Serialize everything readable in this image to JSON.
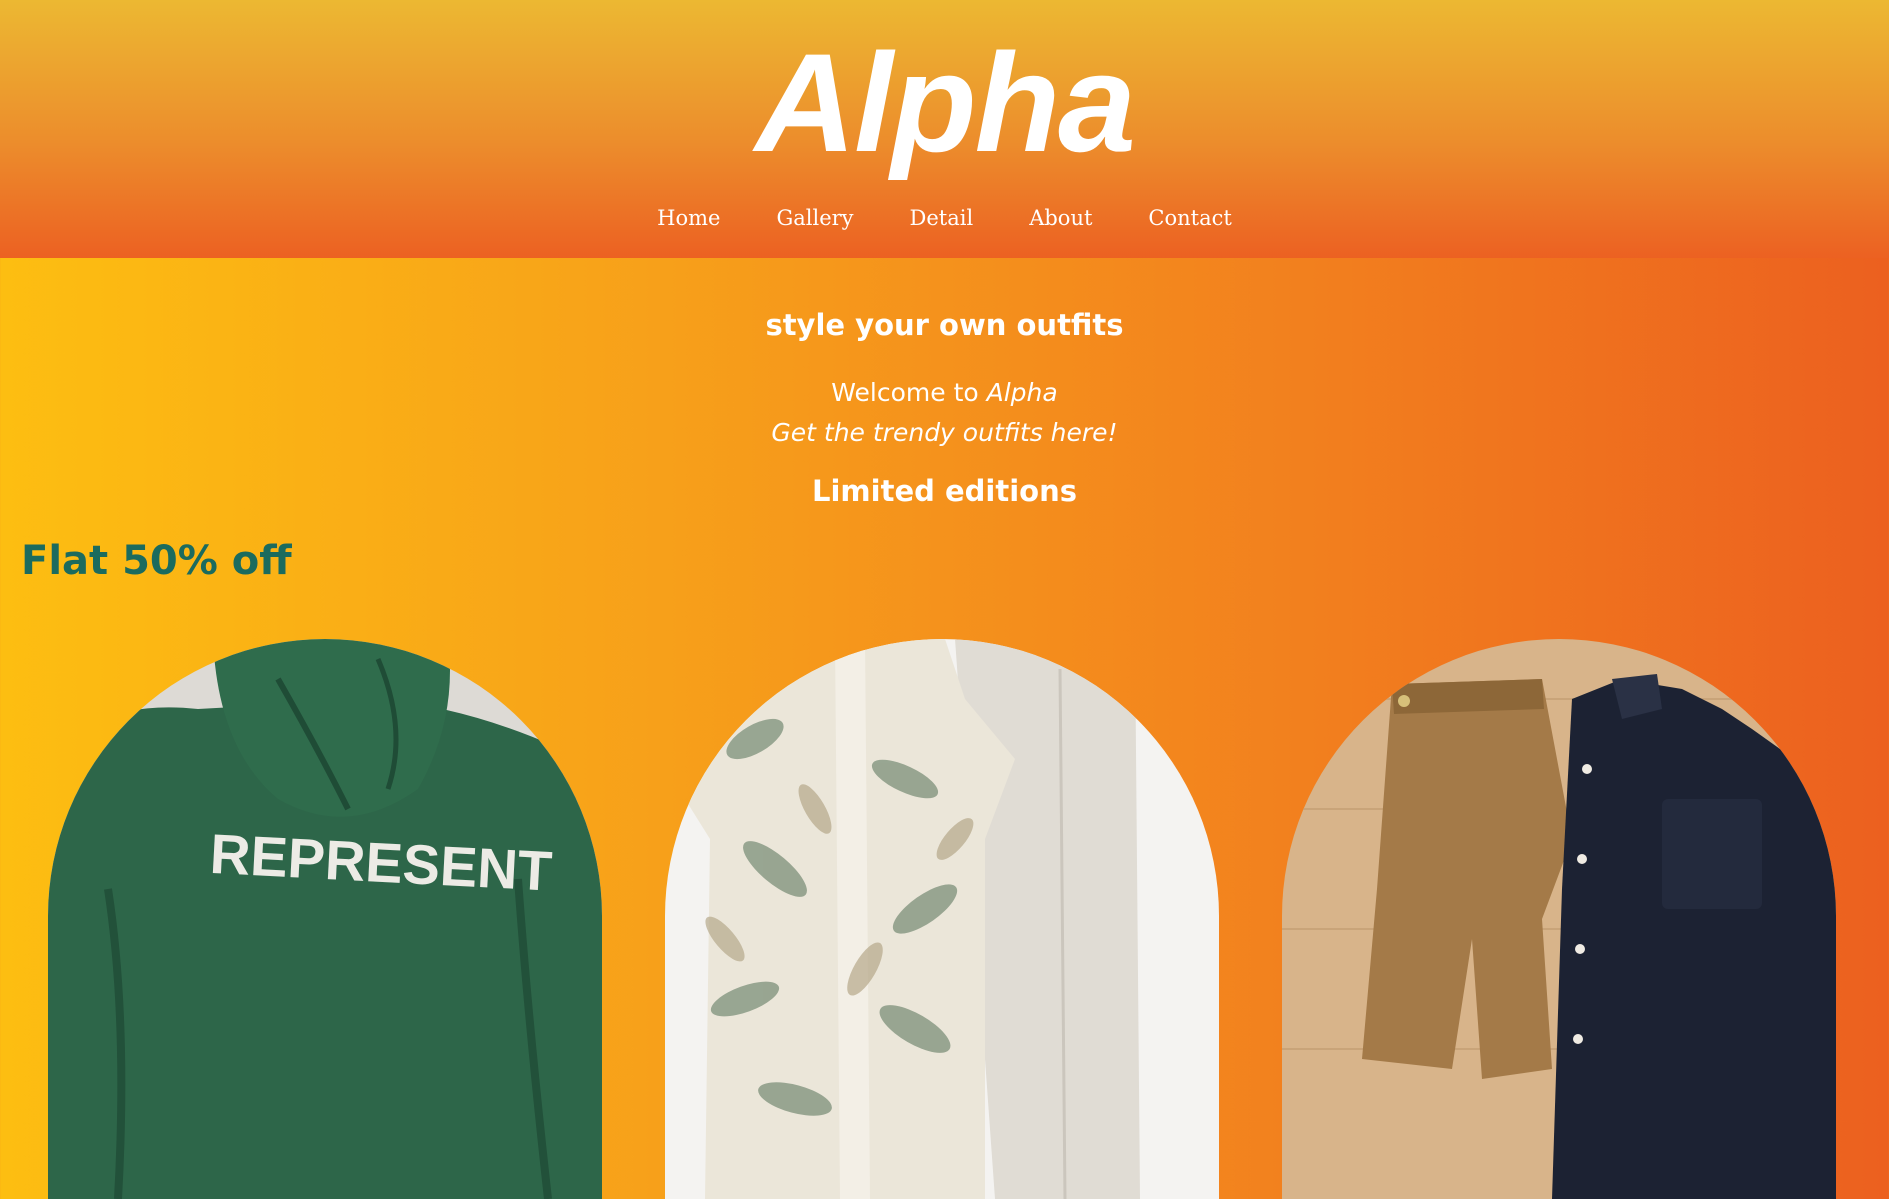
{
  "header": {
    "logo": "Alpha",
    "nav": [
      "Home",
      "Gallery",
      "Detail",
      "About",
      "Contact"
    ]
  },
  "hero": {
    "title": "style your own outfits",
    "welcome_prefix": "Welcome to ",
    "welcome_brand": "Alpha",
    "tagline": "Get the trendy outfits here!",
    "subheading": "Limited editions"
  },
  "promo": {
    "text": "Flat 50% off",
    "color": "#1b6b5e"
  },
  "products": [
    {
      "image": "green-hoodie-image",
      "print": "REPRESENT"
    },
    {
      "image": "floral-shirt-and-pants-image"
    },
    {
      "image": "chinos-and-dark-shirt-image"
    }
  ]
}
